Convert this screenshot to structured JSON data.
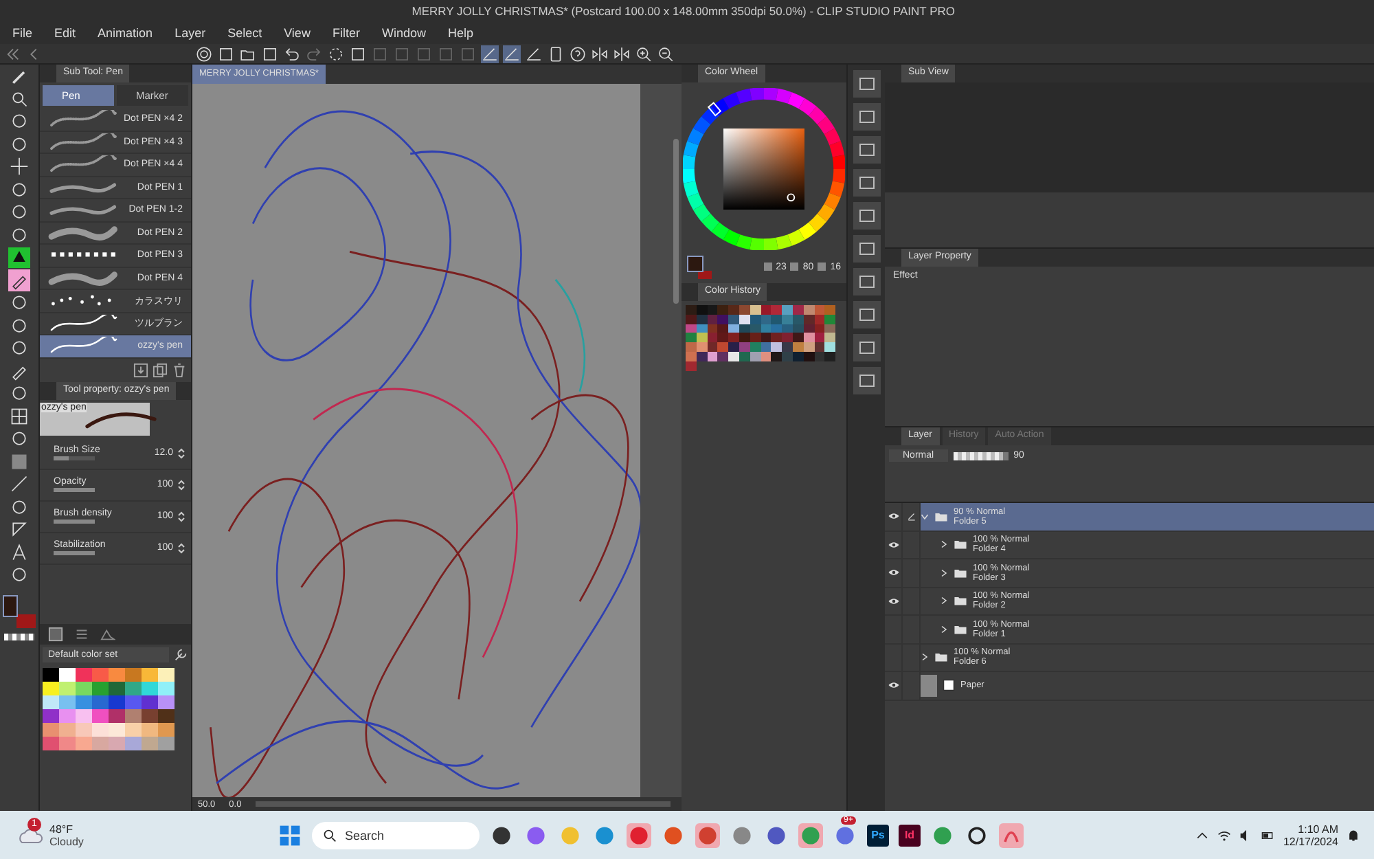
{
  "window": {
    "title": "MERRY JOLLY CHRISTMAS* (Postcard 100.00 x 148.00mm 350dpi 50.0%)  - CLIP STUDIO PAINT PRO"
  },
  "menu": [
    "File",
    "Edit",
    "Animation",
    "Layer",
    "Select",
    "View",
    "Filter",
    "Window",
    "Help"
  ],
  "tools": [
    {
      "selected": false
    },
    {
      "selected": false
    },
    {
      "selected": false
    },
    {
      "selected": false
    },
    {
      "selected": false
    },
    {
      "selected": false
    },
    {
      "selected": false
    },
    {
      "selected": false
    },
    {
      "selected": true
    },
    {
      "selected": false
    },
    {
      "selected": false
    },
    {
      "selected": false
    },
    {
      "selected": false
    },
    {
      "selected": false
    },
    {
      "selected": false
    },
    {
      "selected": false
    },
    {
      "selected": false
    },
    {
      "selected": false
    },
    {
      "selected": false
    },
    {
      "selected": false
    },
    {
      "selected": false
    },
    {
      "selected": false
    }
  ],
  "sub_tool": {
    "title": "Sub Tool: Pen",
    "tabs": [
      {
        "label": "Pen",
        "selected": true
      },
      {
        "label": "Marker",
        "selected": false
      }
    ],
    "brushes": [
      {
        "label": "Dot PEN ×4 2",
        "kind": "dots",
        "selected": false
      },
      {
        "label": "Dot PEN ×4 3",
        "kind": "dots",
        "selected": false
      },
      {
        "label": "Dot PEN ×4 4",
        "kind": "dots",
        "selected": false
      },
      {
        "label": "Dot PEN 1",
        "kind": "stroke",
        "selected": false
      },
      {
        "label": "Dot PEN 1-2",
        "kind": "stroke",
        "selected": false
      },
      {
        "label": "Dot PEN 2",
        "kind": "thick",
        "selected": false
      },
      {
        "label": "Dot PEN 3",
        "kind": "squares",
        "selected": false
      },
      {
        "label": "Dot PEN 4",
        "kind": "thick",
        "selected": false
      },
      {
        "label": "カラスウリ",
        "kind": "splatter",
        "selected": false
      },
      {
        "label": "ツルブラン",
        "kind": "thin",
        "selected": false
      },
      {
        "label": "ozzy's pen",
        "kind": "thin",
        "selected": true
      }
    ]
  },
  "tool_property": {
    "title": "Tool property: ozzy's pen",
    "preview_label": "ozzy's pen",
    "rows": [
      {
        "label": "Brush Size",
        "value": "12.0",
        "level": 0.35
      },
      {
        "label": "Opacity",
        "value": "100",
        "level": 1
      },
      {
        "label": "Brush density",
        "value": "100",
        "level": 1
      },
      {
        "label": "Stabilization",
        "value": "100",
        "level": 1
      }
    ]
  },
  "color_set": {
    "name": "Default color set",
    "swatches": [
      {
        "color": "#000000"
      },
      {
        "color": "#ffffff"
      },
      {
        "color": "#f0325a"
      },
      {
        "color": "#f85a48"
      },
      {
        "color": "#f88a40"
      },
      {
        "color": "#c87820"
      },
      {
        "color": "#f8b838"
      },
      {
        "color": "#fcf0b8"
      },
      {
        "color": "#f8f020"
      },
      {
        "color": "#c0f070"
      },
      {
        "color": "#78d860"
      },
      {
        "color": "#28a030"
      },
      {
        "color": "#206838"
      },
      {
        "color": "#30a888"
      },
      {
        "color": "#30d8d8"
      },
      {
        "color": "#90f0f8"
      },
      {
        "color": "#c0e8f8"
      },
      {
        "color": "#78c0f0"
      },
      {
        "color": "#3890e0"
      },
      {
        "color": "#2868d0"
      },
      {
        "color": "#1838d0"
      },
      {
        "color": "#5858f0"
      },
      {
        "color": "#6030d0"
      },
      {
        "color": "#b890f8"
      },
      {
        "color": "#9030c8"
      },
      {
        "color": "#e890f0"
      },
      {
        "color": "#f8c0f0"
      },
      {
        "color": "#f050c0"
      },
      {
        "color": "#b03068"
      },
      {
        "color": "#b08070"
      },
      {
        "color": "#784030"
      },
      {
        "color": "#503018"
      },
      {
        "color": "#e89070"
      },
      {
        "color": "#f0b090"
      },
      {
        "color": "#f8c8b8"
      },
      {
        "color": "#fce0d8"
      },
      {
        "color": "#fce8d8"
      },
      {
        "color": "#f8d0a8"
      },
      {
        "color": "#f0b880"
      },
      {
        "color": "#e09850"
      },
      {
        "color": "#e05070"
      },
      {
        "color": "#f08888"
      },
      {
        "color": "#f8a890"
      },
      {
        "color": "#d8a8a0"
      },
      {
        "color": "#d8a8b0"
      },
      {
        "color": "#a8a8d8"
      },
      {
        "color": "#c0a890"
      },
      {
        "color": "#a0a0a0"
      }
    ]
  },
  "color_wheel": {
    "title": "Color Wheel",
    "h": "23",
    "s": "80",
    "v": "16"
  },
  "color_history": {
    "title": "Color History",
    "swatches": [
      {
        "color": "#2c1c14"
      },
      {
        "color": "#101010"
      },
      {
        "color": "#181818"
      },
      {
        "color": "#3c2010"
      },
      {
        "color": "#582818"
      },
      {
        "color": "#8c4830"
      },
      {
        "color": "#d8c090"
      },
      {
        "color": "#981828"
      },
      {
        "color": "#b02838"
      },
      {
        "color": "#58a0c0"
      },
      {
        "color": "#a02848"
      },
      {
        "color": "#c08870"
      },
      {
        "color": "#c05838"
      },
      {
        "color": "#b06020"
      },
      {
        "color": "#501818"
      },
      {
        "color": "#203040"
      },
      {
        "color": "#602040"
      },
      {
        "color": "#401060"
      },
      {
        "color": "#305878"
      },
      {
        "color": "#e0e0f0"
      },
      {
        "color": "#205878"
      },
      {
        "color": "#306888"
      },
      {
        "color": "#205870"
      },
      {
        "color": "#388098"
      },
      {
        "color": "#285868"
      },
      {
        "color": "#602828"
      },
      {
        "color": "#a02828"
      },
      {
        "color": "#208838"
      },
      {
        "color": "#c04888"
      },
      {
        "color": "#4090c0"
      },
      {
        "color": "#803020"
      },
      {
        "color": "#581818"
      },
      {
        "color": "#80b0e0"
      },
      {
        "color": "#204858"
      },
      {
        "color": "#285868"
      },
      {
        "color": "#3080a0"
      },
      {
        "color": "#2870a0"
      },
      {
        "color": "#286080"
      },
      {
        "color": "#285060"
      },
      {
        "color": "#602030"
      },
      {
        "color": "#882020"
      },
      {
        "color": "#886858"
      },
      {
        "color": "#208040"
      },
      {
        "color": "#c0c050"
      },
      {
        "color": "#882030"
      },
      {
        "color": "#601818"
      },
      {
        "color": "#802020"
      },
      {
        "color": "#401810"
      },
      {
        "color": "#682018"
      },
      {
        "color": "#401818"
      },
      {
        "color": "#702020"
      },
      {
        "color": "#802030"
      },
      {
        "color": "#401818"
      },
      {
        "color": "#e090a0"
      },
      {
        "color": "#a02040"
      },
      {
        "color": "#c0b890"
      },
      {
        "color": "#c06848"
      },
      {
        "color": "#e09070"
      },
      {
        "color": "#702828"
      },
      {
        "color": "#c04830"
      },
      {
        "color": "#282048"
      },
      {
        "color": "#904080"
      },
      {
        "color": "#208060"
      },
      {
        "color": "#4070a0"
      },
      {
        "color": "#c0c0e0"
      },
      {
        "color": "#383848"
      },
      {
        "color": "#c08040"
      },
      {
        "color": "#d0a080"
      },
      {
        "color": "#603030"
      },
      {
        "color": "#a0e0e0"
      },
      {
        "color": "#d07050"
      },
      {
        "color": "#402858"
      },
      {
        "color": "#e0a0d0"
      },
      {
        "color": "#603060"
      },
      {
        "color": "#e8e8e8"
      },
      {
        "color": "#206850"
      },
      {
        "color": "#a0a0b0"
      },
      {
        "color": "#e09080"
      },
      {
        "color": "#201818"
      },
      {
        "color": "#304048"
      },
      {
        "color": "#102030"
      },
      {
        "color": "#201010"
      },
      {
        "color": "#303030"
      },
      {
        "color": "#202020"
      },
      {
        "color": "#a02830"
      }
    ]
  },
  "sub_view": {
    "title": "Sub View"
  },
  "layer_property": {
    "title": "Layer Property",
    "effect_label": "Effect"
  },
  "layer_panel": {
    "tabs": [
      {
        "label": "Layer",
        "selected": true
      },
      {
        "label": "History",
        "selected": false
      },
      {
        "label": "Auto Action",
        "selected": false
      }
    ],
    "blend_mode": "Normal",
    "opacity": {
      "value": "90",
      "level": 0.9
    },
    "layers": [
      {
        "mode": "90 % Normal",
        "name": "Folder 5",
        "visible": true,
        "expanded": true,
        "selected": true,
        "kind": "folder",
        "children": [
          {
            "mode": "100 % Normal",
            "name": "Folder 4",
            "visible": true,
            "expanded": false,
            "selected": false,
            "kind": "folder"
          },
          {
            "mode": "100 % Normal",
            "name": "Folder 3",
            "visible": true,
            "expanded": false,
            "selected": false,
            "kind": "folder"
          },
          {
            "mode": "100 % Normal",
            "name": "Folder 2",
            "visible": true,
            "expanded": false,
            "selected": false,
            "kind": "folder"
          },
          {
            "mode": "100 % Normal",
            "name": "Folder 1",
            "visible": false,
            "expanded": false,
            "selected": false,
            "kind": "folder"
          }
        ]
      },
      {
        "mode": "100 % Normal",
        "name": "Folder 6",
        "visible": false,
        "expanded": false,
        "selected": false,
        "kind": "folder"
      },
      {
        "name": "Paper",
        "visible": true,
        "selected": false,
        "kind": "paper"
      }
    ]
  },
  "canvas": {
    "tab": "MERRY JOLLY CHRISTMAS*",
    "zoom": "50.0",
    "rotation": "0.0"
  },
  "taskbar": {
    "temperature": "48°F",
    "weather": "Cloudy",
    "weather_badge": "1",
    "search_placeholder": "Search",
    "ps_label": "Ps",
    "id_label": "Id",
    "discord_badge": "9+",
    "time": "1:10 AM",
    "date": "12/17/2024"
  }
}
